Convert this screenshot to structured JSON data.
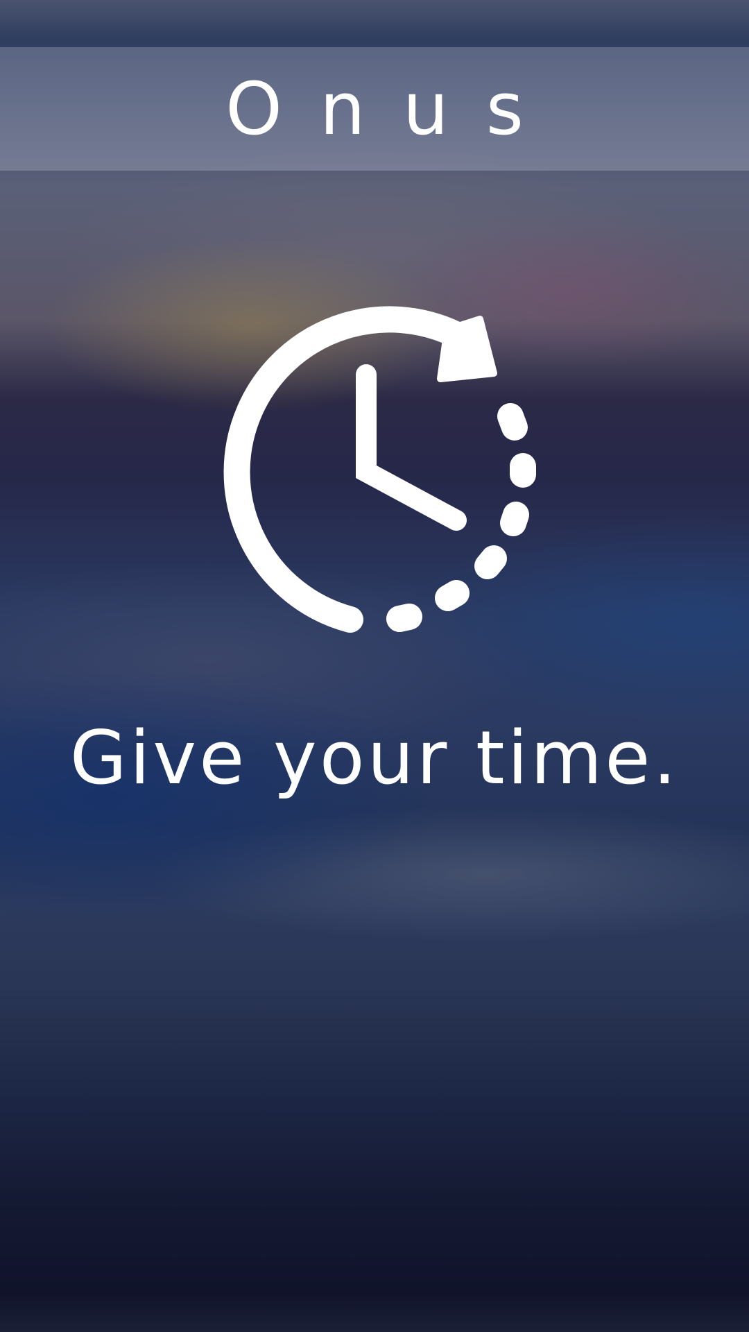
{
  "header": {
    "title": "Onus"
  },
  "hero": {
    "icon": "clock-countdown-icon",
    "tagline": "Give your time."
  },
  "colors": {
    "foreground": "#ffffff",
    "header_band": "rgba(200,205,225,0.28)",
    "background_top": "#4a5470",
    "background_bottom": "#10132a"
  }
}
